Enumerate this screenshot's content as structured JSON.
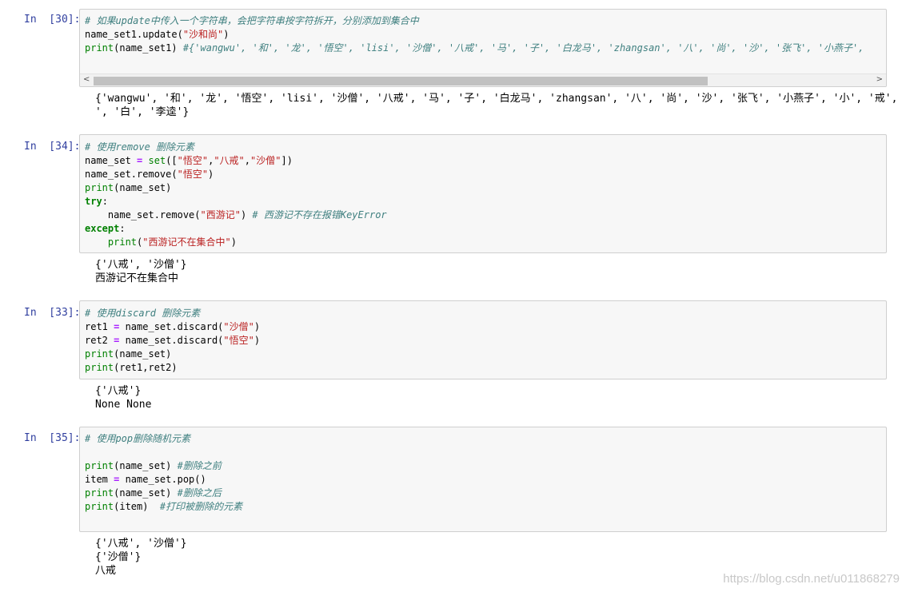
{
  "cells": [
    {
      "prompt": "In  [30]:",
      "code_lines": [
        [
          {
            "t": "# 如果update中传入一个字符串，会把字符串按字符拆开，分别添加到集合中",
            "c": "cm"
          }
        ],
        [
          {
            "t": "name_set1.update(",
            "c": ""
          },
          {
            "t": "\"沙和尚\"",
            "c": "str"
          },
          {
            "t": ")",
            "c": ""
          }
        ],
        [
          {
            "t": "print",
            "c": "bi"
          },
          {
            "t": "(name_set1) ",
            "c": ""
          },
          {
            "t": "#{'wangwu', '和', '龙', '悟空', 'lisi', '沙僧', '八戒', '马', '子', '白龙马', 'zhangsan', '八', '尚', '沙', '张飞', '小燕子',",
            "c": "cm"
          }
        ]
      ],
      "output_lines": [
        "{'wangwu', '和', '龙', '悟空', 'lisi', '沙僧', '八戒', '马', '子', '白龙马', 'zhangsan', '八', '尚', '沙', '张飞', '小燕子', '小', '戒', '燕",
        "', '白', '李逵'}"
      ]
    },
    {
      "prompt": "In  [34]:",
      "code_lines": [
        [
          {
            "t": "# 使用remove 删除元素",
            "c": "cm"
          }
        ],
        [
          {
            "t": "name_set ",
            "c": ""
          },
          {
            "t": "=",
            "c": "op"
          },
          {
            "t": " ",
            "c": ""
          },
          {
            "t": "set",
            "c": "bi"
          },
          {
            "t": "([",
            "c": ""
          },
          {
            "t": "\"悟空\"",
            "c": "str"
          },
          {
            "t": ",",
            "c": ""
          },
          {
            "t": "\"八戒\"",
            "c": "str"
          },
          {
            "t": ",",
            "c": ""
          },
          {
            "t": "\"沙僧\"",
            "c": "str"
          },
          {
            "t": "])",
            "c": ""
          }
        ],
        [
          {
            "t": "name_set.remove(",
            "c": ""
          },
          {
            "t": "\"悟空\"",
            "c": "str"
          },
          {
            "t": ")",
            "c": ""
          }
        ],
        [
          {
            "t": "print",
            "c": "bi"
          },
          {
            "t": "(name_set)",
            "c": ""
          }
        ],
        [
          {
            "t": "try",
            "c": "kw"
          },
          {
            "t": ":",
            "c": ""
          }
        ],
        [
          {
            "t": "    name_set.remove(",
            "c": ""
          },
          {
            "t": "\"西游记\"",
            "c": "str"
          },
          {
            "t": ") ",
            "c": ""
          },
          {
            "t": "# 西游记不存在报错KeyError",
            "c": "cm"
          }
        ],
        [
          {
            "t": "except",
            "c": "kw"
          },
          {
            "t": ":",
            "c": ""
          }
        ],
        [
          {
            "t": "    ",
            "c": ""
          },
          {
            "t": "print",
            "c": "bi"
          },
          {
            "t": "(",
            "c": ""
          },
          {
            "t": "\"西游记不在集合中\"",
            "c": "str"
          },
          {
            "t": ")",
            "c": ""
          }
        ]
      ],
      "output_lines": [
        "{'八戒', '沙僧'}",
        "西游记不在集合中"
      ]
    },
    {
      "prompt": "In  [33]:",
      "code_lines": [
        [
          {
            "t": "# 使用discard 删除元素",
            "c": "cm"
          }
        ],
        [
          {
            "t": "ret1 ",
            "c": ""
          },
          {
            "t": "=",
            "c": "op"
          },
          {
            "t": " name_set.discard(",
            "c": ""
          },
          {
            "t": "\"沙僧\"",
            "c": "str"
          },
          {
            "t": ")",
            "c": ""
          }
        ],
        [
          {
            "t": "ret2 ",
            "c": ""
          },
          {
            "t": "=",
            "c": "op"
          },
          {
            "t": " name_set.discard(",
            "c": ""
          },
          {
            "t": "\"悟空\"",
            "c": "str"
          },
          {
            "t": ")",
            "c": ""
          }
        ],
        [
          {
            "t": "print",
            "c": "bi"
          },
          {
            "t": "(name_set)",
            "c": ""
          }
        ],
        [
          {
            "t": "print",
            "c": "bi"
          },
          {
            "t": "(ret1,ret2)",
            "c": ""
          }
        ]
      ],
      "output_lines": [
        "{'八戒'}",
        "None None"
      ]
    },
    {
      "prompt": "In  [35]:",
      "code_lines": [
        [
          {
            "t": "# 使用pop删除随机元素",
            "c": "cm"
          }
        ],
        [
          {
            "t": "",
            "c": ""
          }
        ],
        [
          {
            "t": "print",
            "c": "bi"
          },
          {
            "t": "(name_set) ",
            "c": ""
          },
          {
            "t": "#删除之前",
            "c": "cm"
          }
        ],
        [
          {
            "t": "item ",
            "c": ""
          },
          {
            "t": "=",
            "c": "op"
          },
          {
            "t": " name_set.pop()",
            "c": ""
          }
        ],
        [
          {
            "t": "print",
            "c": "bi"
          },
          {
            "t": "(name_set) ",
            "c": ""
          },
          {
            "t": "#删除之后",
            "c": "cm"
          }
        ],
        [
          {
            "t": "print",
            "c": "bi"
          },
          {
            "t": "(item)  ",
            "c": ""
          },
          {
            "t": "#打印被删除的元素",
            "c": "cm"
          }
        ]
      ],
      "output_lines": [
        "{'八戒', '沙僧'}",
        "{'沙僧'}",
        "八戒"
      ]
    }
  ],
  "scrollbar": {
    "left_arrow": "<",
    "right_arrow": ">"
  },
  "watermark": "https://blog.csdn.net/u011868279"
}
